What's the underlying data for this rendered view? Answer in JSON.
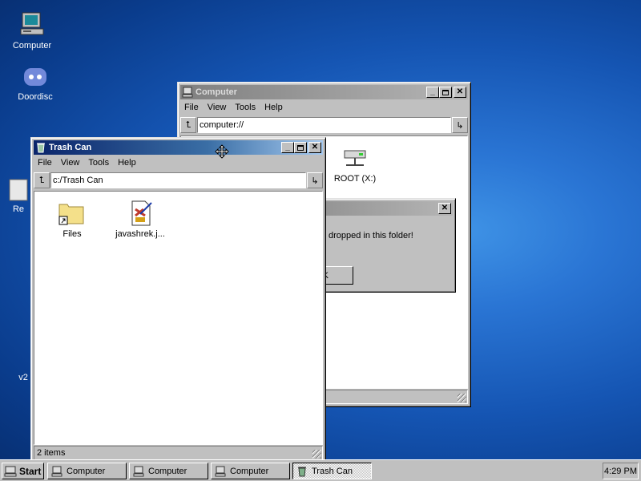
{
  "desktop": {
    "icons": [
      {
        "label": "Computer"
      },
      {
        "label": "Doordisc"
      },
      {
        "label": "Re"
      },
      {
        "label": "v2"
      }
    ]
  },
  "computer_window": {
    "title": "Computer",
    "menu": [
      "File",
      "View",
      "Tools",
      "Help"
    ],
    "address": "computer://",
    "items": [
      {
        "label": "ROOT (X:)"
      }
    ]
  },
  "dialog": {
    "message": "dropped in this folder!",
    "button_label": "K"
  },
  "trash_window": {
    "title": "Trash Can",
    "menu": [
      "File",
      "View",
      "Tools",
      "Help"
    ],
    "address": "c:/Trash Can",
    "items": [
      {
        "label": "Files",
        "icon": "folder-shortcut-icon"
      },
      {
        "label": "javashrek.j...",
        "icon": "java-file-icon"
      }
    ],
    "status": "2 items"
  },
  "taskbar": {
    "start_label": "Start",
    "tasks": [
      {
        "label": "Computer",
        "pressed": false
      },
      {
        "label": "Computer",
        "pressed": false
      },
      {
        "label": "Computer",
        "pressed": false
      },
      {
        "label": "Trash Can",
        "pressed": true
      }
    ],
    "clock": "4:29 PM"
  }
}
